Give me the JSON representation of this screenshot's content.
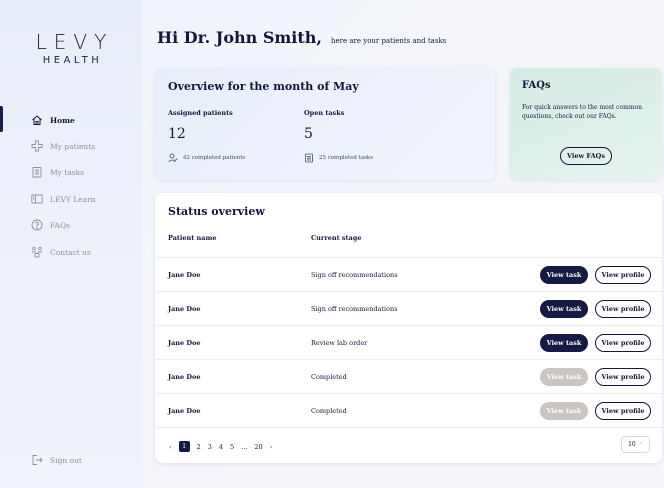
{
  "brand": {
    "name": "LEVY",
    "sub": "HEALTH"
  },
  "sidebar": {
    "items": [
      {
        "label": "Home",
        "icon": "home-icon"
      },
      {
        "label": "My patients",
        "icon": "patients-icon"
      },
      {
        "label": "My tasks",
        "icon": "tasks-icon"
      },
      {
        "label": "LEVY Learn",
        "icon": "learn-icon"
      },
      {
        "label": "FAQs",
        "icon": "help-icon"
      },
      {
        "label": "Contact us",
        "icon": "contact-icon"
      }
    ],
    "sign_out": "Sign out"
  },
  "header": {
    "title": "Hi Dr. John Smith,",
    "subtitle": "here are your patients and tasks"
  },
  "overview": {
    "title": "Overview for the month of May",
    "assigned_label": "Assigned patients",
    "assigned_value": "12",
    "assigned_note": "42 completed patients",
    "open_label": "Open tasks",
    "open_value": "5",
    "open_note": "25 completed tasks"
  },
  "faqs": {
    "title": "FAQs",
    "text": "For quick answers to the most common questions, check out our FAQs.",
    "button": "View FAQs"
  },
  "status": {
    "title": "Status overview",
    "columns": [
      "Patient name",
      "Current stage"
    ],
    "rows": [
      {
        "name": "Jane Doe",
        "stage": "Sign off recommendations",
        "task_enabled": true
      },
      {
        "name": "Jane Doe",
        "stage": "Sign off recommendations",
        "task_enabled": true
      },
      {
        "name": "Jane Doe",
        "stage": "Review lab order",
        "task_enabled": true
      },
      {
        "name": "Jane Doe",
        "stage": "Completed",
        "task_enabled": false
      },
      {
        "name": "Jane Doe",
        "stage": "Completed",
        "task_enabled": false
      }
    ],
    "view_task": "View task",
    "view_profile": "View profile",
    "pagination": {
      "prev": "‹",
      "pages": [
        "1",
        "2",
        "3",
        "4",
        "5",
        "...",
        "20"
      ],
      "current": "1",
      "next": "›"
    },
    "per_page": "10"
  },
  "colors": {
    "primary": "#141a44",
    "disabled": "#c9c5c2",
    "faq_bg": "#d3ece4"
  }
}
